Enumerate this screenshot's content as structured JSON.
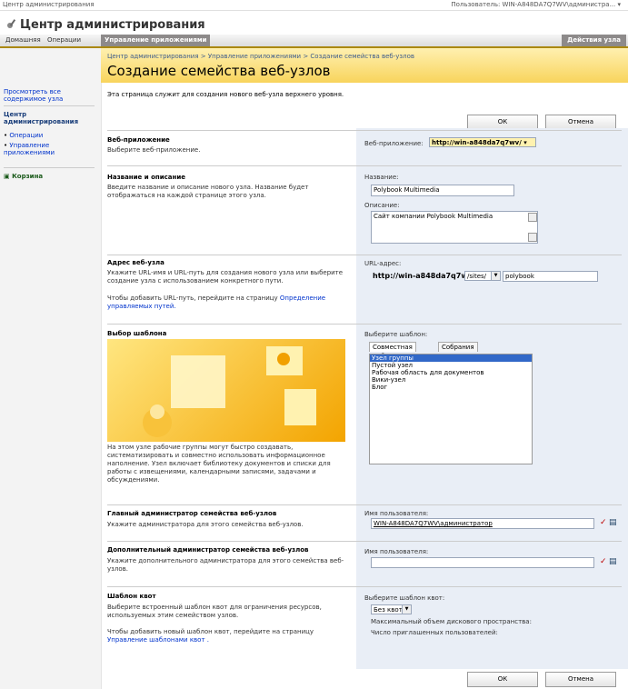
{
  "topbar": {
    "site": "Центр администрирования",
    "user": "Пользователь: WIN-A848DA7Q7WV\\администра... ▾"
  },
  "header": {
    "title": "Центр администрирования"
  },
  "tabs": [
    "Домашняя",
    "Операции",
    "Управление приложениями"
  ],
  "actions_label": "Действия узла",
  "leftnav": {
    "view_all": "Просмотреть все содержимое узла",
    "center": "Центр администрирования",
    "items": [
      "Операции",
      "Управление приложениями"
    ],
    "recycle": "Корзина"
  },
  "page": {
    "breadcrumb": "Центр администрирования > Управление приложениями > Создание семейства веб-узлов",
    "title": "Создание семейства веб-узлов",
    "description": "Эта страница служит для создания нового веб-узла верхнего уровня."
  },
  "buttons": {
    "ok": "ОК",
    "cancel": "Отмена"
  },
  "sections": {
    "webapp": {
      "title": "Веб-приложение",
      "text": "Выберите веб-приложение.",
      "label": "Веб-приложение:",
      "value": "http://win-a848da7q7wv/ ▾"
    },
    "name": {
      "title": "Название и описание",
      "text": "Введите название и описание нового узла. Название будет отображаться на каждой странице этого узла.",
      "name_label": "Название:",
      "name_value": "Polybook Multimedia",
      "desc_label": "Описание:",
      "desc_value": "Сайт компании Polybook Multimedia"
    },
    "url": {
      "title": "Адрес веб-узла",
      "text": "Укажите URL-имя и URL-путь для создания нового узла или выберите создание узла с использованием конкретного пути.",
      "text2": "Чтобы добавить URL-путь, перейдите на страницу",
      "link": "Определение управляемых путей.",
      "label": "URL-адрес:",
      "base": "http://win-a848da7q7wv",
      "path": "/sites/",
      "name": "polybook"
    },
    "template": {
      "title": "Выбор шаблона",
      "label": "Выберите шаблон:",
      "tab1": "Совместная работа",
      "tab2": "Собрания",
      "items": [
        "Узел группы",
        "Пустой узел",
        "Рабочая область для документов",
        "Вики-узел",
        "Блог"
      ],
      "text": "На этом узле рабочие группы могут быстро создавать, систематизировать и совместно использовать информационное наполнение. Узел включает библиотеку документов и списки для работы с извещениями, календарными записями, задачами и обсуждениями."
    },
    "admin": {
      "title": "Главный администратор семейства веб-узлов",
      "text": "Укажите администратора для этого семейства веб-узлов.",
      "label": "Имя пользователя:",
      "value": "WIN-A848DA7Q7WV\\администратор"
    },
    "admin2": {
      "title": "Дополнительный администратор семейства веб-узлов",
      "text": "Укажите дополнительного администратора для этого семейства веб-узлов.",
      "label": "Имя пользователя:",
      "value": ""
    },
    "quota": {
      "title": "Шаблон квот",
      "text": "Выберите встроенный шаблон квот для ограничения ресурсов, используемых этим семейством узлов.",
      "text2": "Чтобы добавить новый шаблон квот, перейдите на страницу",
      "link": "Управление шаблонами квот .",
      "label": "Выберите шаблон квот:",
      "value": "Без квоты",
      "storage": "Максимальный объем дискового пространства:",
      "users": "Число приглашенных пользователей:"
    }
  }
}
